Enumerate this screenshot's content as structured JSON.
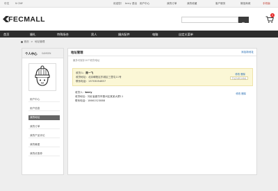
{
  "topbar": {
    "language": "中文",
    "currency": "¥ CNY",
    "welcome": "欢迎您！",
    "username": "terry",
    "logout": "退出",
    "account": "用户中心",
    "my_orders": "我的订单",
    "favorites": "我的收藏",
    "service": "客户服务",
    "wechat": "微信商城",
    "mobile": "手机版"
  },
  "header": {
    "brand": "FECMALL",
    "search": {
      "value": "",
      "placeholder": ""
    },
    "hotwords": [
      "卫衣",
      "针织衫",
      "T恤",
      "连衣裙",
      "短裤",
      "衬衫",
      "外套"
    ],
    "cart_count": "0"
  },
  "nav": {
    "items": [
      "首页",
      "婚礼",
      "特殊场合",
      "男人",
      "婚庆配件",
      "电脑",
      "自定义菜单"
    ]
  },
  "breadcrumb": {
    "home": "首页",
    "separator": ">",
    "current": "地址管理"
  },
  "sidebar": {
    "title": "个人中心",
    "username": "SAMSEN",
    "items": [
      "用户中心",
      "用户信息",
      "我的地址",
      "我的订单",
      "我的产品评论",
      "我的最爱",
      "我的优惠券"
    ],
    "active_index": 2
  },
  "main": {
    "title": "地址管理",
    "add_link": "添加新地址",
    "subtitle": "最多可保存10个收货地址",
    "addresses": [
      {
        "name_label": "收货人：",
        "name": "陈一飞",
        "addr_label": "收货地址：",
        "address": "北京朝阳区东城区三里屯11号",
        "phone_label": "联系电话：",
        "phone": "13703054857",
        "edit": "修改",
        "delete": "删除",
        "default_btn": "已设为默认地址"
      },
      {
        "name_label": "收货人：",
        "name": "terry",
        "addr_label": "收货地址：",
        "address": "河北省廊坊市霸州区某某大厦11",
        "phone_label": "联系电话：",
        "phone": "18661523888",
        "edit": "修改",
        "delete": "删除"
      }
    ]
  },
  "colors": {
    "nav_bg": "#2d2d2d",
    "active_sidebar": "#666666",
    "default_address_bg": "#fbf7d6",
    "link": "#2a6fb4",
    "cart_badge": "#e62a2a"
  }
}
